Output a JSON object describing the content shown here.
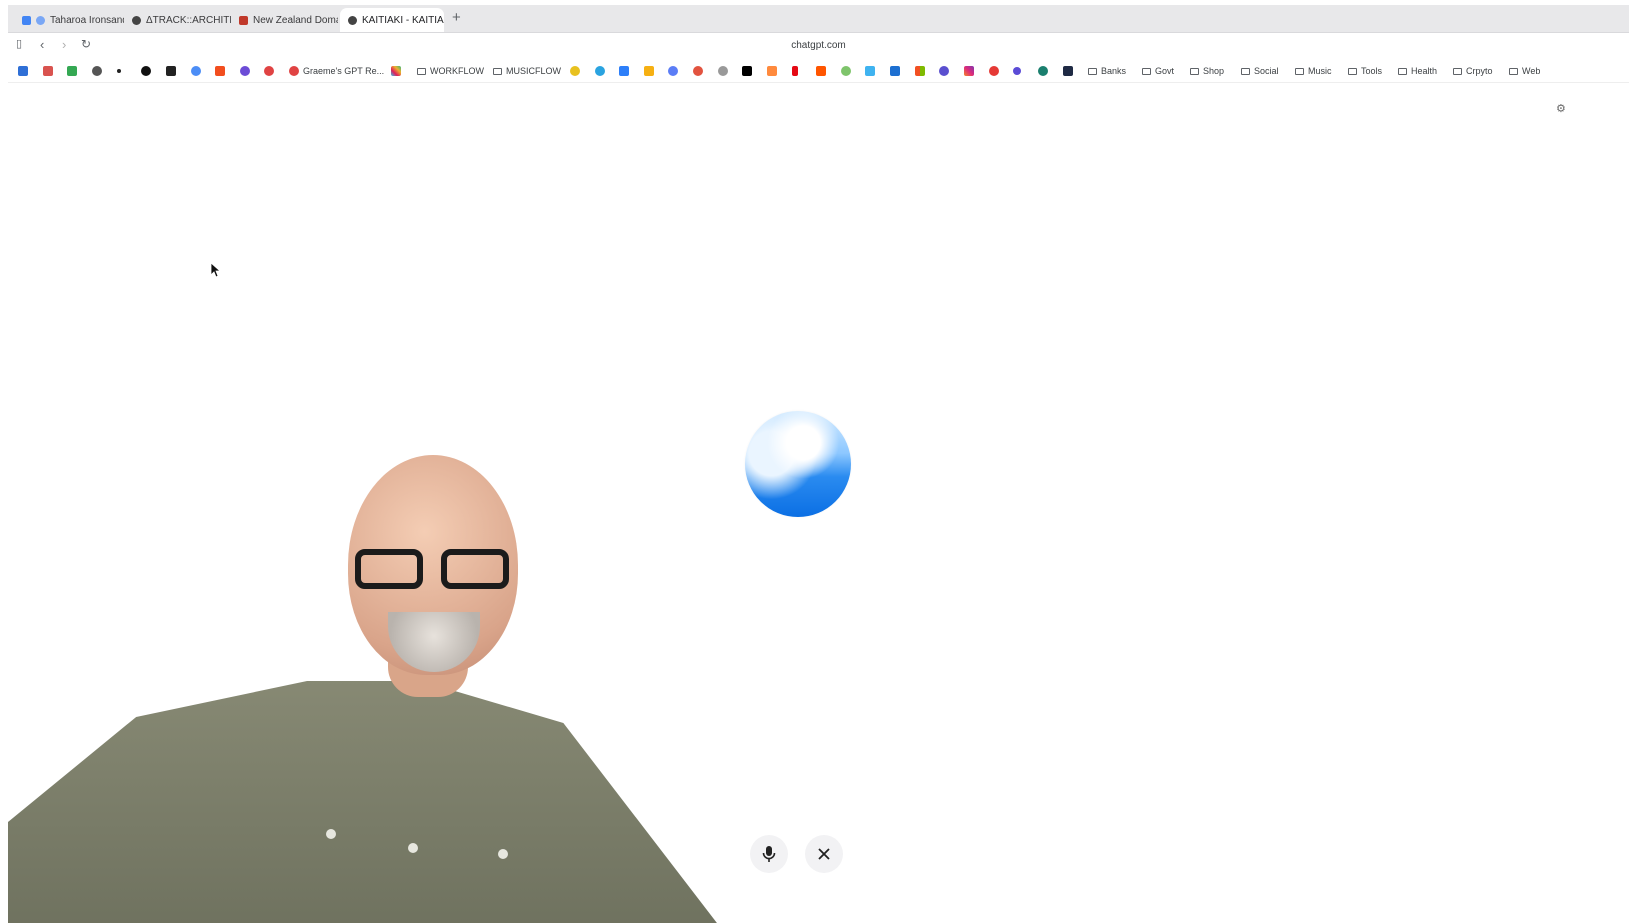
{
  "browser": {
    "tabs": [
      {
        "label": "Taharoa Ironsand",
        "active": false,
        "favicon_color": "#4285f4"
      },
      {
        "label": "ΔTRACK::ARCHITEC",
        "active": false,
        "favicon_color": "#444444"
      },
      {
        "label": "New Zealand Domain",
        "active": false,
        "favicon_color": "#c0392b"
      },
      {
        "label": "KAITIAKI - KAITIA",
        "active": true,
        "favicon_color": "#444444"
      }
    ],
    "new_tab_label": "+",
    "url": "chatgpt.com"
  },
  "bookmarks_bar": {
    "named": [
      {
        "label": "Graeme's GPT Re...",
        "type": "link"
      },
      {
        "label": "WORKFLOW",
        "type": "folder"
      },
      {
        "label": "MUSICFLOW",
        "type": "folder"
      },
      {
        "label": "Banks",
        "type": "folder"
      },
      {
        "label": "Govt",
        "type": "folder"
      },
      {
        "label": "Shop",
        "type": "folder"
      },
      {
        "label": "Social",
        "type": "folder"
      },
      {
        "label": "Music",
        "type": "folder"
      },
      {
        "label": "Tools",
        "type": "folder"
      },
      {
        "label": "Health",
        "type": "folder"
      },
      {
        "label": "Crpyto",
        "type": "folder"
      },
      {
        "label": "Web",
        "type": "folder"
      }
    ]
  },
  "voice_mode": {
    "mic_icon": "microphone-icon",
    "close_icon": "close-icon",
    "orb_colors": {
      "top": "#d6ecff",
      "bottom": "#0b6fe4"
    }
  }
}
